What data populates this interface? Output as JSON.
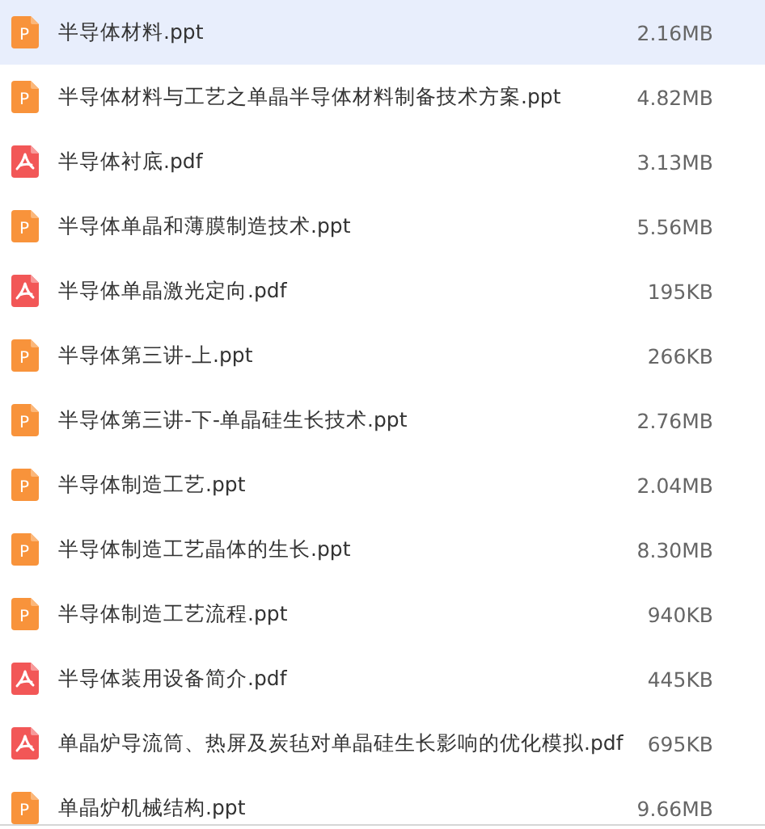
{
  "files": [
    {
      "kind": "ppt",
      "icon_letter": "P",
      "name": "半导体材料.ppt",
      "size": "2.16MB",
      "selected": true
    },
    {
      "kind": "ppt",
      "icon_letter": "P",
      "name": "半导体材料与工艺之单晶半导体材料制备技术方案.ppt",
      "size": "4.82MB",
      "selected": false
    },
    {
      "kind": "pdf",
      "name": "半导体衬底.pdf",
      "size": "3.13MB",
      "selected": false
    },
    {
      "kind": "ppt",
      "icon_letter": "P",
      "name": "半导体单晶和薄膜制造技术.ppt",
      "size": "5.56MB",
      "selected": false
    },
    {
      "kind": "pdf",
      "name": "半导体单晶激光定向.pdf",
      "size": "195KB",
      "selected": false
    },
    {
      "kind": "ppt",
      "icon_letter": "P",
      "name": "半导体第三讲-上.ppt",
      "size": "266KB",
      "selected": false
    },
    {
      "kind": "ppt",
      "icon_letter": "P",
      "name": "半导体第三讲-下-单晶硅生长技术.ppt",
      "size": "2.76MB",
      "selected": false
    },
    {
      "kind": "ppt",
      "icon_letter": "P",
      "name": "半导体制造工艺.ppt",
      "size": "2.04MB",
      "selected": false
    },
    {
      "kind": "ppt",
      "icon_letter": "P",
      "name": "半导体制造工艺晶体的生长.ppt",
      "size": "8.30MB",
      "selected": false
    },
    {
      "kind": "ppt",
      "icon_letter": "P",
      "name": "半导体制造工艺流程.ppt",
      "size": "940KB",
      "selected": false
    },
    {
      "kind": "pdf",
      "name": "半导体装用设备简介.pdf",
      "size": "445KB",
      "selected": false
    },
    {
      "kind": "pdf",
      "name": "单晶炉导流筒、热屏及炭毡对单晶硅生长影响的优化模拟.pdf",
      "size": "695KB",
      "selected": false
    },
    {
      "kind": "ppt",
      "icon_letter": "P",
      "name": "单晶炉机械结构.ppt",
      "size": "9.66MB",
      "selected": false
    }
  ]
}
